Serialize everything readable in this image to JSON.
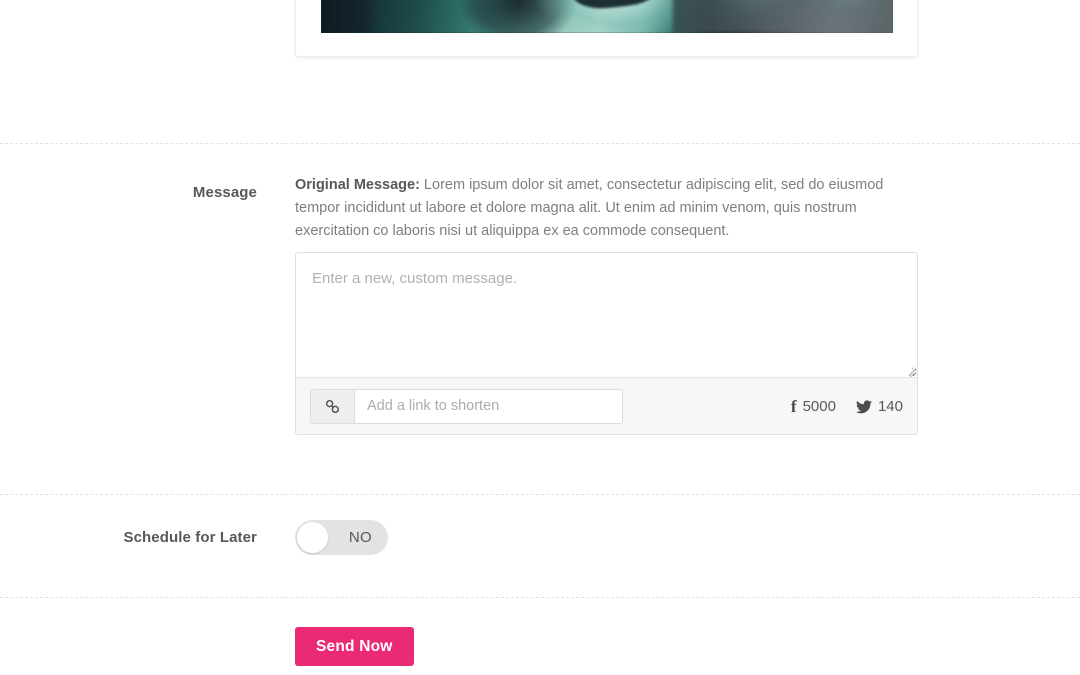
{
  "preview": {
    "image_alt": "teal motorcycle helmet photo"
  },
  "message_section": {
    "label": "Message",
    "original_prefix": "Original Message:",
    "original_text": " Lorem ipsum dolor sit amet, consectetur adipiscing elit, sed do eiusmod tempor incididunt ut labore et dolore magna alit. Ut enim ad minim venom, quis nostrum exercitation co laboris nisi ut aliquippa ex ea commode consequent.",
    "textarea_value": "",
    "textarea_placeholder": "Enter a new, custom message.",
    "link_input_value": "",
    "link_input_placeholder": "Add a link to shorten",
    "counters": [
      {
        "network": "facebook",
        "value": "5000"
      },
      {
        "network": "twitter",
        "value": "140"
      }
    ]
  },
  "schedule_section": {
    "label": "Schedule for Later",
    "toggle_state": "NO"
  },
  "actions": {
    "send_label": "Send Now",
    "send_color": "#eb2a76"
  }
}
